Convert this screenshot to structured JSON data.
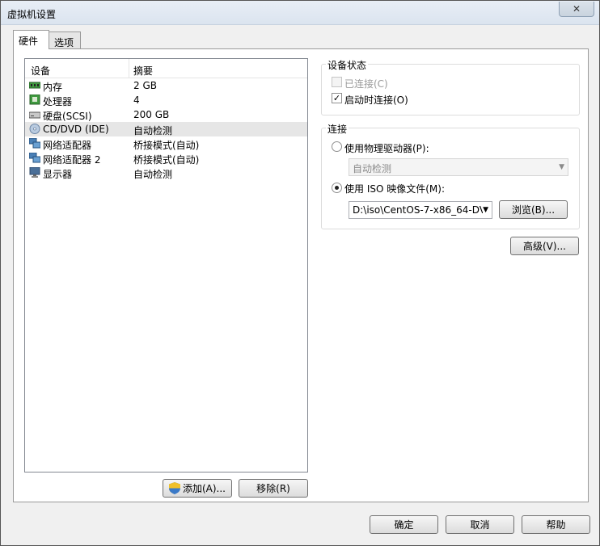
{
  "window": {
    "title": "虚拟机设置",
    "close_glyph": "✕"
  },
  "tabs": [
    {
      "label": "硬件"
    },
    {
      "label": "选项"
    }
  ],
  "device_list": {
    "headers": {
      "device": "设备",
      "summary": "摘要"
    },
    "rows": [
      {
        "name": "内存",
        "summary": "2 GB",
        "icon": "memory-icon"
      },
      {
        "name": "处理器",
        "summary": "4",
        "icon": "processor-icon"
      },
      {
        "name": "硬盘(SCSI)",
        "summary": "200 GB",
        "icon": "harddisk-icon"
      },
      {
        "name": "CD/DVD (IDE)",
        "summary": "自动检测",
        "icon": "cd-dvd-icon"
      },
      {
        "name": "网络适配器",
        "summary": "桥接模式(自动)",
        "icon": "network-adapter-icon"
      },
      {
        "name": "网络适配器 2",
        "summary": "桥接模式(自动)",
        "icon": "network-adapter-icon"
      },
      {
        "name": "显示器",
        "summary": "自动检测",
        "icon": "display-icon"
      }
    ],
    "add_button": "添加(A)...",
    "remove_button": "移除(R)"
  },
  "device_status": {
    "title": "设备状态",
    "connected_label": "已连接(C)",
    "connect_at_power_on_label": "启动时连接(O)"
  },
  "connection": {
    "title": "连接",
    "physical_drive_label": "使用物理驱动器(P):",
    "physical_drive_value": "自动检测",
    "iso_label": "使用 ISO 映像文件(M):",
    "iso_value": "D:\\iso\\CentOS-7-x86_64-DV",
    "browse_button": "浏览(B)..."
  },
  "advanced_button": "高级(V)...",
  "footer": {
    "ok_button": "确定",
    "cancel_button": "取消",
    "help_button": "帮助"
  }
}
